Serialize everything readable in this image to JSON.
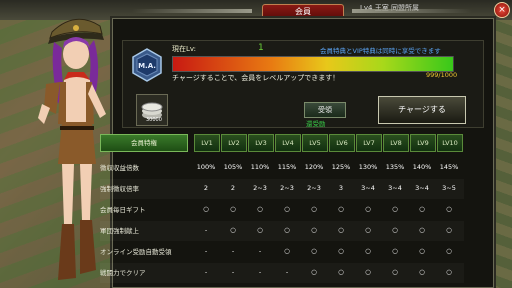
{
  "window": {
    "title": "会員",
    "close_label": "×"
  },
  "hud": {
    "top_text": "Lv4 王室 同盟所属"
  },
  "membership": {
    "current_label": "現在Lv:",
    "current_level": "1",
    "notice": "会員特典とVIP特典は同時に享受できます",
    "exp_value": "999/1000",
    "exp_fraction": 0.999,
    "charge_message": "チャージすることで、会員をレベルアップできます！",
    "badge_text": "M.A.",
    "coin_amount": "30000",
    "receive_label": "受領",
    "unclaimed_label": "還受励",
    "charge_button": "チャージする"
  },
  "table": {
    "header_label": "会員特権",
    "levels": [
      "LV1",
      "LV2",
      "LV3",
      "LV4",
      "LV5",
      "LV6",
      "LV7",
      "LV8",
      "LV9",
      "LV10"
    ],
    "rows": [
      {
        "label": "徴収収益倍数",
        "values": [
          "100%",
          "105%",
          "110%",
          "115%",
          "120%",
          "125%",
          "130%",
          "135%",
          "140%",
          "145%"
        ]
      },
      {
        "label": "強制徴収倍率",
        "values": [
          "2",
          "2",
          "2~3",
          "2~3",
          "2~3",
          "3",
          "3~4",
          "3~4",
          "3~4",
          "3~5"
        ]
      },
      {
        "label": "会員毎日ギフト",
        "values": [
          "○",
          "○",
          "○",
          "○",
          "○",
          "○",
          "○",
          "○",
          "○",
          "○"
        ]
      },
      {
        "label": "軍団強制献上",
        "values": [
          "-",
          "○",
          "○",
          "○",
          "○",
          "○",
          "○",
          "○",
          "○",
          "○"
        ]
      },
      {
        "label": "オンライン受励自動受領",
        "values": [
          "-",
          "-",
          "-",
          "○",
          "○",
          "○",
          "○",
          "○",
          "○",
          "○"
        ]
      },
      {
        "label": "戦闘力でクリア",
        "values": [
          "-",
          "-",
          "-",
          "-",
          "○",
          "○",
          "○",
          "○",
          "○",
          "○"
        ]
      }
    ]
  },
  "colors": {
    "accent_green": "#6cd13a",
    "notice_blue": "#5aa2f0",
    "exp_gold": "#f0c830"
  }
}
